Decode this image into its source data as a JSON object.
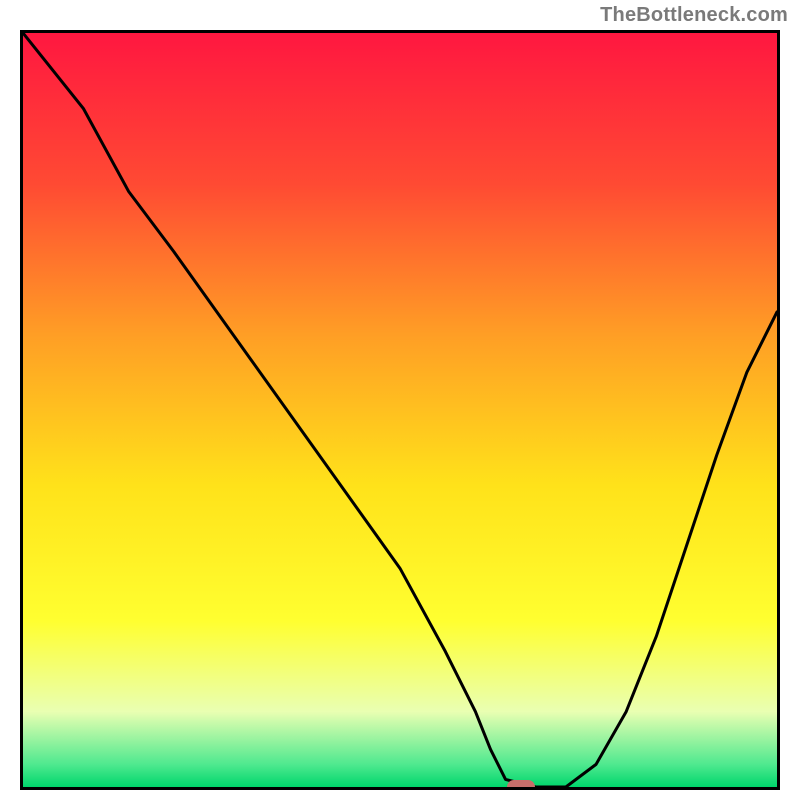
{
  "watermark": "TheBottleneck.com",
  "chart_data": {
    "type": "line",
    "title": "",
    "xlabel": "",
    "ylabel": "",
    "xlim": [
      0,
      100
    ],
    "ylim": [
      0,
      100
    ],
    "gradient_stops": [
      {
        "offset": 0,
        "color": "#ff1740"
      },
      {
        "offset": 20,
        "color": "#ff4a33"
      },
      {
        "offset": 40,
        "color": "#ff9e25"
      },
      {
        "offset": 60,
        "color": "#ffe21a"
      },
      {
        "offset": 78,
        "color": "#ffff30"
      },
      {
        "offset": 90,
        "color": "#e9ffb2"
      },
      {
        "offset": 97,
        "color": "#4fe98f"
      },
      {
        "offset": 100,
        "color": "#00d66c"
      }
    ],
    "series": [
      {
        "name": "bottleneck-curve",
        "x": [
          0,
          8,
          14,
          20,
          30,
          40,
          50,
          56,
          60,
          62,
          64,
          68,
          72,
          76,
          80,
          84,
          88,
          92,
          96,
          100
        ],
        "values": [
          100,
          90,
          79,
          71,
          57,
          43,
          29,
          18,
          10,
          5,
          1,
          0,
          0,
          3,
          10,
          20,
          32,
          44,
          55,
          63
        ]
      }
    ],
    "marker": {
      "x": 66,
      "y": 0,
      "label": "optimal-point"
    }
  }
}
